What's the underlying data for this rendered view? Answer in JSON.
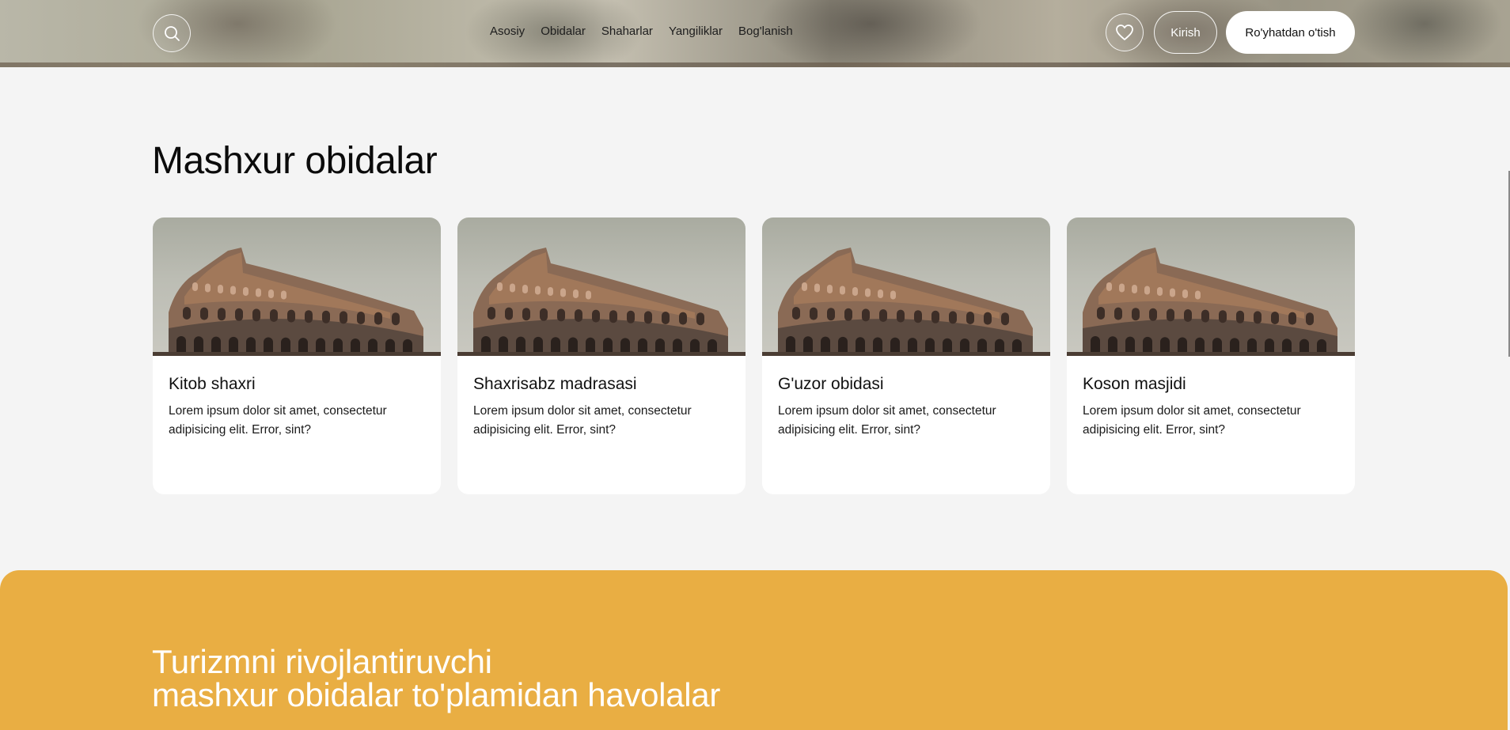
{
  "header": {
    "nav": [
      "Asosiy",
      "Obidalar",
      "Shaharlar",
      "Yangiliklar",
      "Bog'lanish"
    ],
    "login_label": "Kirish",
    "register_label": "Ro'yhatdan o'tish",
    "icons": {
      "search": "search-icon",
      "favorites": "heart-icon"
    }
  },
  "section": {
    "title": "Mashxur obidalar",
    "cards": [
      {
        "title": "Kitob shaxri",
        "description": "Lorem ipsum dolor sit amet, consectetur adipisicing elit. Error, sint?",
        "image": "colosseum-photo"
      },
      {
        "title": "Shaxrisabz madrasasi",
        "description": "Lorem ipsum dolor sit amet, consectetur adipisicing elit. Error, sint?",
        "image": "colosseum-photo"
      },
      {
        "title": "G'uzor obidasi",
        "description": "Lorem ipsum dolor sit amet, consectetur adipisicing elit. Error, sint?",
        "image": "colosseum-photo"
      },
      {
        "title": "Koson masjidi",
        "description": "Lorem ipsum dolor sit amet, consectetur adipisicing elit. Error, sint?",
        "image": "colosseum-photo"
      }
    ]
  },
  "banner": {
    "title_line1": "Turizmni rivojlantiruvchi",
    "title_line2": "mashxur obidalar to'plamidan havolalar",
    "color": "#e9ae43"
  }
}
